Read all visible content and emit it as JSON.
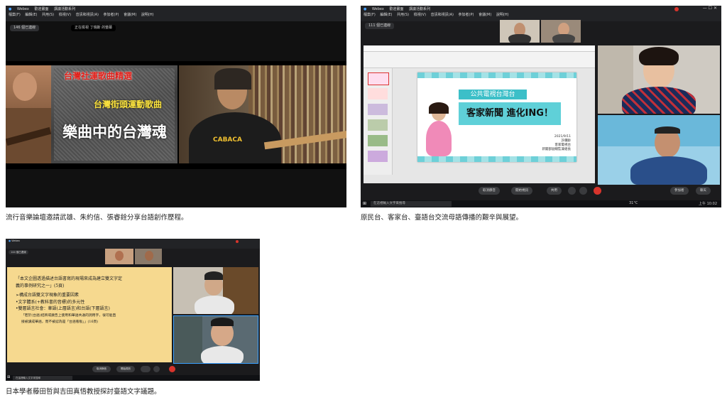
{
  "panel1": {
    "app": "Webex",
    "tabs": [
      "歡迎畫面",
      "講議活動系列"
    ],
    "menus": [
      "檔案(F)",
      "編輯(E)",
      "共用(S)",
      "檢視(V)",
      "音訊和視訊(A)",
      "參加者(P)",
      "會議(M)",
      "說明(H)"
    ],
    "viewers": "146 個已連線",
    "sharing_text": "正在檢視 丁瑞斯 的螢幕",
    "slide_red_text": "台灣社運歌曲精選",
    "slide_yellow_text": "台灣街頭運動歌曲",
    "slide_title": "樂曲中的台灣魂",
    "shirt_text": "CABACA",
    "caption": "流行音樂論壇邀請武雄、朱約信、張睿銓分享台語創作歷程。"
  },
  "panel2": {
    "app": "Webex",
    "tabs": [
      "歡迎畫面",
      "講議活動系列"
    ],
    "menus": [
      "檔案(F)",
      "編輯(E)",
      "共用(S)",
      "檢視(V)",
      "音訊和視訊(A)",
      "參加者(P)",
      "會議(M)",
      "說明(H)"
    ],
    "viewers": "111 個已連線",
    "slide_banner": "公共電視台灣台",
    "slide_title": "客家新聞 進化ING！",
    "slide_date": "2021/9/11",
    "slide_author": "許儷齡",
    "slide_org1": "客家電視台",
    "slide_org2": "新聞部副總監兼組長",
    "controls": [
      "取消靜音",
      "開始視訊",
      "共用",
      "參加者",
      "聊天"
    ],
    "search_placeholder": "在這裡輸入文字來搜尋",
    "weather": "31°C",
    "clock": "上午 10:02",
    "caption": "原民台、客家台、臺語台交流母語傳播的艱辛與展望。"
  },
  "panel3": {
    "app": "Webex",
    "viewers": "144 個已連線",
    "slide_lines": [
      "「本文企圖透過描述台語書寫的現場來成為建立雙文字定",
      "義的事例研究之一」(5頁)",
      "➢構成台語雙文字現象的重要因素",
      "•文字體系(+教科書的音標)的多元性",
      "•雙層語言社會：華語(上層語言)和台語(下層語言)",
      "「若於(台語)招牌或廣告上使用和華語共通的詞用字，很可能直",
      "接被讀成華語，而不被認為是「台語看板」」(16頁)"
    ],
    "controls": [
      "取消靜音",
      "開始視訊"
    ],
    "search_placeholder": "在這裡輸入文字來搜尋",
    "caption": "日本學者藤田哲與吉田真悟教授探討臺語文字議題。"
  },
  "colors": {
    "webex_blue": "#1a73e8",
    "red": "#d8342c",
    "slide_bg": "#f6d98f"
  }
}
